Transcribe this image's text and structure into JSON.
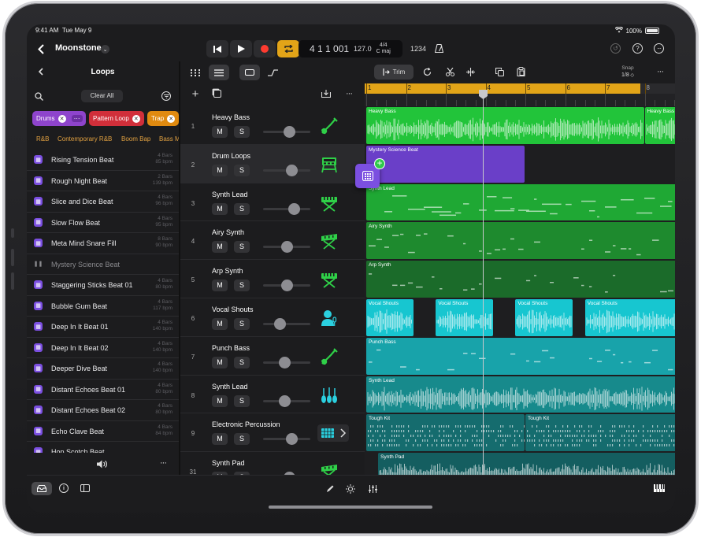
{
  "status": {
    "time": "9:41 AM",
    "date": "Tue May 9",
    "battery": "100%"
  },
  "header": {
    "project": "Moonstone"
  },
  "lcd": {
    "position": "4 1 1 001",
    "tempo": "127.0",
    "signature": "4/4",
    "key": "C maj",
    "count_in": "1234"
  },
  "loops": {
    "title": "Loops",
    "clear_all": "Clear All",
    "filters": [
      {
        "label": "Drums",
        "color": "#8e44cc"
      },
      {
        "label": "Pattern Loop",
        "color": "#d12f3a"
      },
      {
        "label": "Trap",
        "color": "#e08a10"
      }
    ],
    "genres": [
      "R&B",
      "Contemporary R&B",
      "Boom Bap",
      "Bass M"
    ],
    "items": [
      {
        "name": "Rising Tension Beat",
        "bars": "4 Bars",
        "bpm": "85 bpm"
      },
      {
        "name": "Rough Night Beat",
        "bars": "2 Bars",
        "bpm": "139 bpm"
      },
      {
        "name": "Slice and Dice Beat",
        "bars": "4 Bars",
        "bpm": "96 bpm"
      },
      {
        "name": "Slow Flow Beat",
        "bars": "4 Bars",
        "bpm": "95 bpm"
      },
      {
        "name": "Meta Mind Snare Fill",
        "bars": "8 Bars",
        "bpm": "90 bpm"
      },
      {
        "name": "Mystery Science Beat",
        "bars": "",
        "bpm": ""
      },
      {
        "name": "Staggering Sticks Beat 01",
        "bars": "4 Bars",
        "bpm": "80 bpm"
      },
      {
        "name": "Bubble Gum Beat",
        "bars": "4 Bars",
        "bpm": "117 bpm"
      },
      {
        "name": "Deep In It Beat 01",
        "bars": "4 Bars",
        "bpm": "140 bpm"
      },
      {
        "name": "Deep In It Beat 02",
        "bars": "4 Bars",
        "bpm": "140 bpm"
      },
      {
        "name": "Deeper Dive Beat",
        "bars": "4 Bars",
        "bpm": "140 bpm"
      },
      {
        "name": "Distant Echoes Beat 01",
        "bars": "4 Bars",
        "bpm": "80 bpm"
      },
      {
        "name": "Distant Echoes Beat 02",
        "bars": "4 Bars",
        "bpm": "80 bpm"
      },
      {
        "name": "Echo Clave Beat",
        "bars": "4 Bars",
        "bpm": "84 bpm"
      },
      {
        "name": "Hop Scotch Beat",
        "bars": "",
        "bpm": ""
      }
    ]
  },
  "tracks": [
    {
      "num": "1",
      "name": "Heavy Bass",
      "icon": "bass-guitar-icon",
      "mute": "M",
      "solo": "S",
      "volume": 0.55
    },
    {
      "num": "2",
      "name": "Drum Loops",
      "icon": "drum-machine-icon",
      "mute": "M",
      "solo": "S",
      "volume": 0.6
    },
    {
      "num": "3",
      "name": "Synth Lead",
      "icon": "keyboard-icon",
      "mute": "M",
      "solo": "S",
      "volume": 0.65
    },
    {
      "num": "4",
      "name": "Airy Synth",
      "icon": "synth-icon",
      "mute": "M",
      "solo": "S",
      "volume": 0.5
    },
    {
      "num": "5",
      "name": "Arp Synth",
      "icon": "keyboard-icon",
      "mute": "M",
      "solo": "S",
      "volume": 0.5
    },
    {
      "num": "6",
      "name": "Vocal Shouts",
      "icon": "vocalist-icon",
      "mute": "M",
      "solo": "S",
      "volume": 0.35
    },
    {
      "num": "7",
      "name": "Punch Bass",
      "icon": "bass-guitar-icon",
      "mute": "M",
      "solo": "S",
      "volume": 0.45
    },
    {
      "num": "8",
      "name": "Synth Lead",
      "icon": "strings-icon",
      "mute": "M",
      "solo": "S",
      "volume": 0.45
    },
    {
      "num": "9",
      "name": "Electronic Percussion",
      "icon": "drum-pad-icon",
      "mute": "M",
      "solo": "S",
      "volume": 0.6
    },
    {
      "num": "31",
      "name": "Synth Pad",
      "icon": "synth-icon",
      "mute": "M",
      "solo": "S",
      "volume": 0.55
    }
  ],
  "timeline": {
    "trim_label": "Trim",
    "snap_label": "Snap",
    "snap_value": "1/8",
    "bars": [
      "1",
      "2",
      "3",
      "4",
      "5",
      "6",
      "7",
      "8"
    ],
    "regions": [
      {
        "track": 0,
        "name": "Heavy Bass",
        "start": 1,
        "end": 8,
        "type": "audio",
        "color": "#22c43a"
      },
      {
        "track": 0,
        "name": "Heavy Bass",
        "start": 8,
        "end": 9,
        "type": "audio",
        "color": "#22c43a"
      },
      {
        "track": 1,
        "name": "Mystery Science Beat",
        "start": 1,
        "end": 5,
        "type": "pattern",
        "color": "#6a3fc8"
      },
      {
        "track": 2,
        "name": "Synth Lead",
        "start": 1,
        "end": 9,
        "type": "midi",
        "color": "#1fa834"
      },
      {
        "track": 3,
        "name": "Airy Synth",
        "start": 1,
        "end": 9,
        "type": "midi",
        "color": "#1e8a2e"
      },
      {
        "track": 4,
        "name": "Arp Synth",
        "start": 1,
        "end": 9,
        "type": "midi",
        "color": "#1b6b2a"
      },
      {
        "track": 5,
        "name": "Vocal Shouts",
        "start": 1,
        "end": 2.2,
        "type": "audio",
        "color": "#17c6d0"
      },
      {
        "track": 5,
        "name": "Vocal Shouts",
        "start": 2.75,
        "end": 4.2,
        "type": "audio",
        "color": "#17c6d0"
      },
      {
        "track": 5,
        "name": "Vocal Shouts",
        "start": 4.75,
        "end": 6.2,
        "type": "audio",
        "color": "#17c6d0"
      },
      {
        "track": 5,
        "name": "Vocal Shouts",
        "start": 6.5,
        "end": 9,
        "type": "audio",
        "color": "#17c6d0"
      },
      {
        "track": 6,
        "name": "Punch Bass",
        "start": 1,
        "end": 9,
        "type": "midi",
        "color": "#18a3aa"
      },
      {
        "track": 7,
        "name": "Synth Lead",
        "start": 1,
        "end": 9,
        "type": "audio",
        "color": "#178a8c"
      },
      {
        "track": 8,
        "name": "Tough Kit",
        "start": 1,
        "end": 5,
        "type": "pattern",
        "color": "#156c6e"
      },
      {
        "track": 8,
        "name": "Tough Kit",
        "start": 5,
        "end": 9,
        "type": "pattern",
        "color": "#156c6e"
      },
      {
        "track": 9,
        "name": "Synth Pad",
        "start": 1.3,
        "end": 9,
        "type": "audio",
        "color": "#145e60"
      }
    ]
  }
}
